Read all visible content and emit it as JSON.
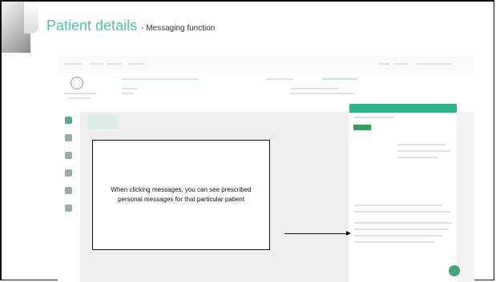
{
  "slide": {
    "title": "Patient details",
    "subtitle": "- Messaging function",
    "callout_text": "When clicking messages, you can see prescribed personal messages for that particular patient"
  },
  "colors": {
    "title": "#4fc2a7",
    "panel_header": "#2fb58a",
    "fab": "#3fa87a"
  },
  "icons": [
    "send-icon"
  ]
}
